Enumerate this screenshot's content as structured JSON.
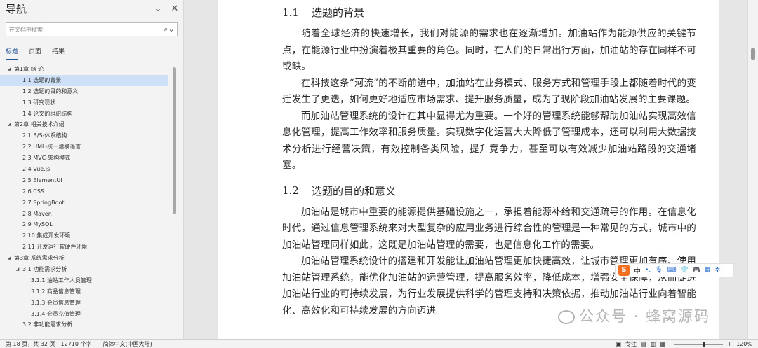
{
  "nav": {
    "title": "导航",
    "search_placeholder": "在文档中搜索",
    "tabs": [
      {
        "label": "标题",
        "active": true
      },
      {
        "label": "页面",
        "active": false
      },
      {
        "label": "结果",
        "active": false
      }
    ],
    "tree": [
      {
        "label": "第1章 绪 论",
        "level": 0,
        "arrow": "▲"
      },
      {
        "label": "1.1 选题的背景",
        "level": 1,
        "selected": true
      },
      {
        "label": "1.2 选题的目的和意义",
        "level": 1
      },
      {
        "label": "1.3 研究现状",
        "level": 1
      },
      {
        "label": "1.4 论文的组织结构",
        "level": 1
      },
      {
        "label": "第2章 相关技术介绍",
        "level": 0,
        "arrow": "▲"
      },
      {
        "label": "2.1 B/S-体系结构",
        "level": 1
      },
      {
        "label": "2.2 UML-统一建模语言",
        "level": 1
      },
      {
        "label": "2.3 MVC-架构模式",
        "level": 1
      },
      {
        "label": "2.4 Vue.js",
        "level": 1
      },
      {
        "label": "2.5 ElementUI",
        "level": 1
      },
      {
        "label": "2.6 CSS",
        "level": 1
      },
      {
        "label": "2.7 SpringBoot",
        "level": 1
      },
      {
        "label": "2.8 Maven",
        "level": 1
      },
      {
        "label": "2.9 MySQL",
        "level": 1
      },
      {
        "label": "2.10 集成开发环境",
        "level": 1
      },
      {
        "label": "2.11 开发运行软硬件环境",
        "level": 1
      },
      {
        "label": "第3章 系统需求分析",
        "level": 0,
        "arrow": "▲"
      },
      {
        "label": "3.1 功能需求分析",
        "level": 1,
        "arrow": "▲"
      },
      {
        "label": "3.1.1 油站工作人员管理",
        "level": 2
      },
      {
        "label": "3.1.2 商品信息管理",
        "level": 2
      },
      {
        "label": "3.1.3 会员信息管理",
        "level": 2
      },
      {
        "label": "3.1.4 会员充值管理",
        "level": 2
      },
      {
        "label": "3.2 非功能需求分析",
        "level": 1
      }
    ]
  },
  "doc": {
    "h1_num": "1.1",
    "h1_title": "选题的背景",
    "p1": "随着全球经济的快速增长，我们对能源的需求也在逐渐增加。加油站作为能源供应的关键节点，在能源行业中扮演着极其重要的角色。同时，在人们的日常出行方面，加油站的存在同样不可或缺。",
    "p2": "在科技这条“河流”的不断前进中，加油站在业务模式、服务方式和管理手段上都随着时代的变迁发生了更迭，如何更好地适应市场需求、提升服务质量，成为了现阶段加油站发展的主要课题。",
    "p3": "而加油站管理系统的设计在其中显得尤为重要。一个好的管理系统能够帮助加油站实现高效信息化管理，提高工作效率和服务质量。实现数字化运营大大降低了管理成本，还可以利用大数据技术分析进行经营决策，有效控制各类风险，提升竞争力，甚至可以有效减少加油站路段的交通堵塞。",
    "h2_num": "1.2",
    "h2_title": "选题的目的和意义",
    "p4": "加油站是城市中重要的能源提供基础设施之一，承担着能源补给和交通疏导的作用。在信息化时代，通过信息管理系统来对大型复杂的应用业务进行综合性的管理是一种常见的方式，城市中的加油站管理同样如此，这既是加油站管理的需要，也是信息化工作的需要。",
    "p5": "加油站管理系统设计的搭建和开发能让加油站管理更加快捷高效，让城市管理更加有序。使用加油站管理系统，能优化加油站的运营管理，提高服务效率，降低成本，增强安全保障，从而促进加油站行业的可持续发展，为行业发展提供科学的管理支持和决策依据，推动加油站行业向着智能化、高效化和可持续发展的方向迈进。"
  },
  "ime": {
    "logo": "S",
    "label": "中"
  },
  "watermark": "公众号 · 蜂窝源码",
  "status": {
    "page": "第 18 页，共 32 页",
    "words": "12710 个字",
    "lang": "简体中文(中国大陆)",
    "focus": "专注",
    "zoom": "120%",
    "zoom_fraction": 0.6
  }
}
